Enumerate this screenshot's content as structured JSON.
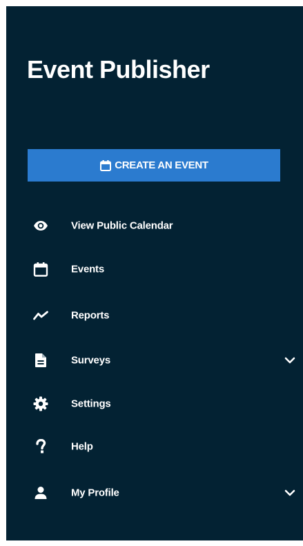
{
  "app": {
    "title": "Event Publisher"
  },
  "create_button": {
    "label": "CREATE AN EVENT",
    "icon": "calendar-icon"
  },
  "nav": {
    "items": [
      {
        "label": "View Public Calendar",
        "icon": "eye-icon",
        "expandable": false
      },
      {
        "label": "Events",
        "icon": "calendar-icon",
        "expandable": false
      },
      {
        "label": "Reports",
        "icon": "trend-line-icon",
        "expandable": false
      },
      {
        "label": "Surveys",
        "icon": "document-icon",
        "expandable": true
      },
      {
        "label": "Settings",
        "icon": "gear-icon",
        "expandable": false
      },
      {
        "label": "Help",
        "icon": "question-mark-icon",
        "expandable": false
      },
      {
        "label": "My Profile",
        "icon": "user-icon",
        "expandable": true
      }
    ]
  },
  "colors": {
    "sidebar_background": "#032233",
    "button_background": "#2b7bcf",
    "text": "#ffffff",
    "page_background": "#ffffff"
  }
}
